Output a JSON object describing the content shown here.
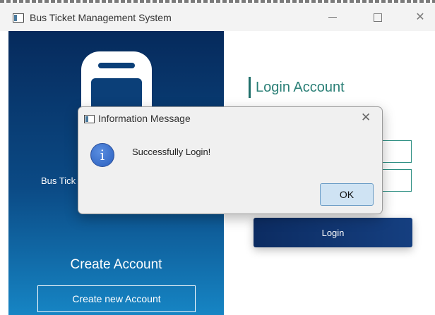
{
  "window": {
    "title": "Bus Ticket Management System",
    "minimize_icon": "minimize-icon",
    "maximize_icon": "maximize-icon",
    "close_glyph": "✕"
  },
  "left_panel": {
    "logo_icon": "bus-icon",
    "tagline": "Bus Tick",
    "create_title": "Create Account",
    "create_button": "Create new Account"
  },
  "login": {
    "heading": "Login Account",
    "username_value": "",
    "password_value": "",
    "login_button": "Login"
  },
  "dialog": {
    "title": "Information Message",
    "close_glyph": "✕",
    "icon": "info-icon",
    "info_glyph": "i",
    "message": "Successfully Login!",
    "ok_button": "OK"
  },
  "colors": {
    "panel_top": "#062a5c",
    "panel_bottom": "#1685c4",
    "accent_teal": "#2a7f76",
    "login_button": "#0c2c62",
    "ok_button": "#cfe3f3"
  }
}
